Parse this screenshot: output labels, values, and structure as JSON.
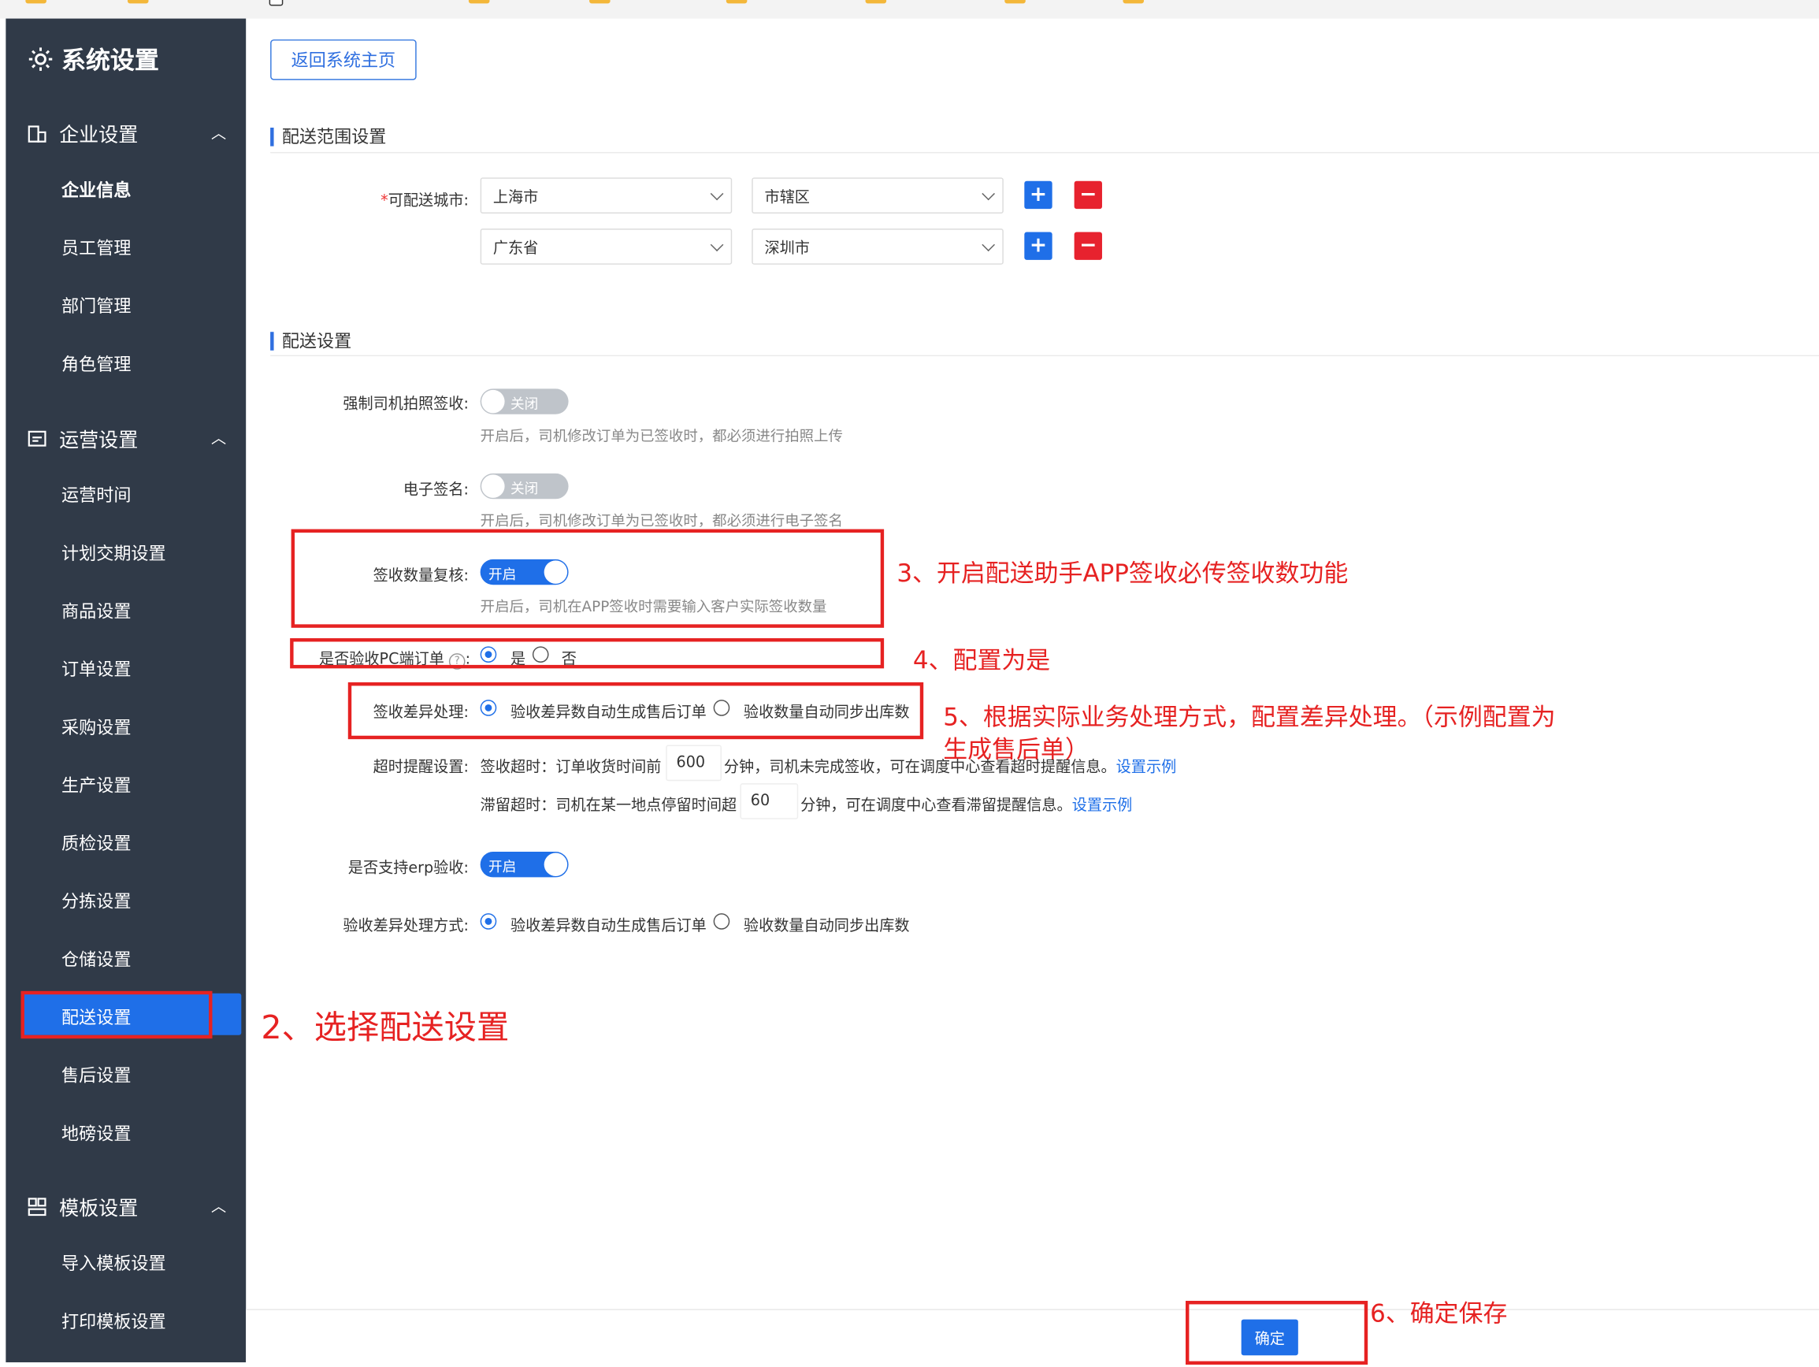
{
  "sidebar": {
    "title": "系统设置",
    "groups": [
      {
        "label": "企业设置",
        "items": [
          "企业信息",
          "员工管理",
          "部门管理",
          "角色管理"
        ]
      },
      {
        "label": "运营设置",
        "items": [
          "运营时间",
          "计划交期设置",
          "商品设置",
          "订单设置",
          "采购设置",
          "生产设置",
          "质检设置",
          "分拣设置",
          "仓储设置",
          "配送设置",
          "售后设置",
          "地磅设置"
        ]
      },
      {
        "label": "模板设置",
        "items": [
          "导入模板设置",
          "打印模板设置"
        ]
      }
    ],
    "active_item": "配送设置"
  },
  "back_button": "返回系统主页",
  "range_section": {
    "title": "配送范围设置",
    "city_label": "可配送城市:",
    "required_mark": "*",
    "rows": [
      {
        "province": "上海市",
        "city": "市辖区"
      },
      {
        "province": "广东省",
        "city": "深圳市"
      }
    ],
    "plus": "+",
    "minus": "−"
  },
  "delivery_section": {
    "title": "配送设置",
    "photo_sign": {
      "label": "强制司机拍照签收:",
      "state": "关闭",
      "help": "开启后，司机修改订单为已签收时，都必须进行拍照上传"
    },
    "e_sign": {
      "label": "电子签名:",
      "state": "关闭",
      "help": "开启后，司机修改订单为已签收时，都必须进行电子签名"
    },
    "qty_check": {
      "label": "签收数量复核:",
      "state": "开启",
      "help": "开启后，司机在APP签收时需要输入客户实际签收数量"
    },
    "pc_accept": {
      "label": "是否验收PC端订单",
      "help_icon": "?",
      "colon": ":",
      "opt_yes": "是",
      "opt_no": "否",
      "selected": "是"
    },
    "diff_handle": {
      "label": "签收差异处理:",
      "opt1": "验收差异数自动生成售后订单",
      "opt2": "验收数量自动同步出库数",
      "selected": 1
    },
    "timeout": {
      "label": "超时提醒设置:",
      "line1_prefix": "签收超时：订单收货时间前",
      "line1_value": "600",
      "line1_suffix": "分钟，司机未完成签收，可在调度中心查看超时提醒信息。",
      "line1_link": "设置示例",
      "line2_prefix": "滞留超时：司机在某一地点停留时间超",
      "line2_value": "60",
      "line2_suffix": "分钟，可在调度中心查看滞留提醒信息。",
      "line2_link": "设置示例"
    },
    "erp_accept": {
      "label": "是否支持erp验收:",
      "state": "开启"
    },
    "accept_diff": {
      "label": "验收差异处理方式:",
      "opt1": "验收差异数自动生成售后订单",
      "opt2": "验收数量自动同步出库数",
      "selected": 1
    }
  },
  "annotations": {
    "a2": "2、选择配送设置",
    "a3": "3、开启配送助手APP签收必传签收数功能",
    "a4": "4、配置为是",
    "a5_line1": "5、根据实际业务处理方式，配置差异处理。（示例配置为",
    "a5_line2": "生成售后单）",
    "a6": "6、确定保存"
  },
  "confirm_button": "确定",
  "colors": {
    "sidebar_bg": "#303a48",
    "primary": "#1f6fe8",
    "danger": "#e7222e",
    "annotation": "#e62222"
  }
}
